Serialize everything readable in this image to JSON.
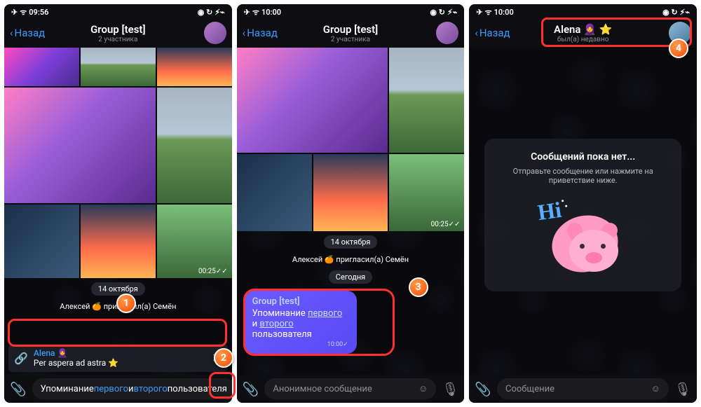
{
  "status": {
    "time1": "09:56",
    "time2": "10:00",
    "time3": "10:00",
    "plane": "✈︎",
    "wifi": "ᯤ",
    "batt": "⚡︎⌁"
  },
  "nav": {
    "back": "Назад",
    "title12": "Group [test]",
    "sub12": "2 участника",
    "title3": "Alena 🧕 ⭐",
    "sub3": "был(а) недавно"
  },
  "chat": {
    "date": "14 октября",
    "today": "Сегодня",
    "sys_a": "Алексей",
    "sys_mid": "пригласил(а)",
    "sys_b": "Семён",
    "media_time": "00:25✓✓"
  },
  "reply": {
    "name": "Alena 🧕",
    "text": "Per aspera ad astra ⭐"
  },
  "input1": {
    "pre": "Упоминание ",
    "l1": "первого",
    "mid": " и ",
    "l2": "второго",
    "post": " пользователя"
  },
  "input2": "Анонимное сообщение",
  "input3": "Сообщение",
  "bubble": {
    "title": "Group [test]",
    "pre": "Упоминание ",
    "l1": "первого",
    "mid": " и ",
    "l2": "второго",
    "post": "пользователя",
    "time": "10:00✓"
  },
  "empty": {
    "title": "Сообщений пока нет...",
    "sub": "Отправьте сообщение или нажмите на приветствие ниже.",
    "hi": "Hi"
  },
  "badges": {
    "b1": "1",
    "b2": "2",
    "b3": "3",
    "b4": "4"
  }
}
